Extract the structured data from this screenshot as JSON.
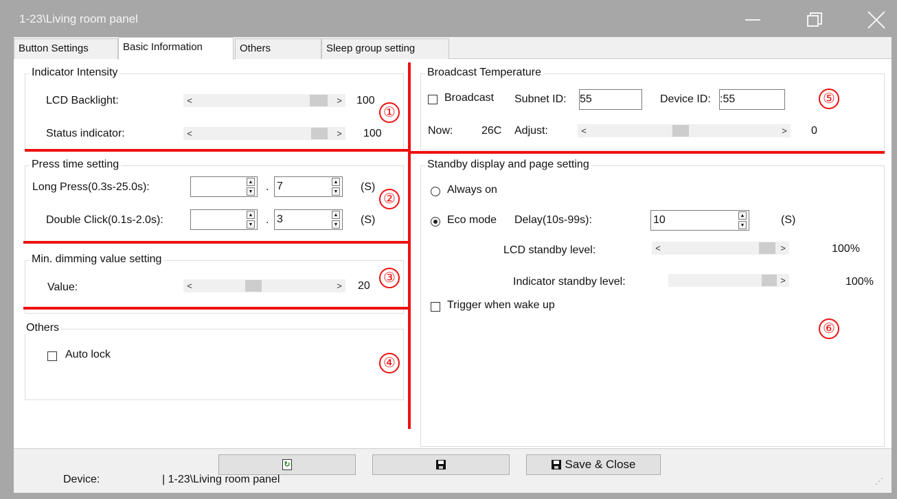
{
  "window": {
    "title": "1-23\\Living room panel",
    "minimize": "—",
    "restore": "❐",
    "close": "✕"
  },
  "tabs": [
    {
      "label": "Button Settings"
    },
    {
      "label": "Basic Information"
    },
    {
      "label": "Others"
    },
    {
      "label": "Sleep group setting"
    }
  ],
  "indicator": {
    "title": "Indicator Intensity",
    "lcd_label": "LCD Backlight:",
    "lcd_value": "100",
    "status_label": "Status indicator:",
    "status_value": "100"
  },
  "press": {
    "title": "Press time setting",
    "long_label": "Long Press(0.3s-25.0s):",
    "long_int": "",
    "long_frac": "7",
    "double_label": "Double Click(0.1s-2.0s):",
    "double_int": "",
    "double_frac": "3",
    "dot": ".",
    "unit": "(S)"
  },
  "dimming": {
    "title": "Min. dimming value setting",
    "value_label": "Value:",
    "value": "20"
  },
  "others": {
    "title": "Others",
    "auto_lock": "Auto lock"
  },
  "broadcast": {
    "title": "Broadcast Temperature",
    "broadcast_label": "Broadcast",
    "subnet_label": "Subnet ID:",
    "subnet_value": "55",
    "device_label": "Device ID:",
    "device_value": ":55",
    "now_label": "Now:",
    "now_value": "26C",
    "adjust_label": "Adjust:",
    "adjust_value": "0"
  },
  "standby": {
    "title": "Standby display and page setting",
    "always_on": "Always on",
    "eco_mode": "Eco mode",
    "delay_label": "Delay(10s-99s):",
    "delay_value": "10",
    "unit": "(S)",
    "lcd_level_label": "LCD standby level:",
    "lcd_level_value": "100%",
    "indicator_level_label": "Indicator standby level:",
    "indicator_level_value": "100%",
    "trigger_label": "Trigger when wake up"
  },
  "markers": [
    "①",
    "②",
    "③",
    "④",
    "⑤",
    "⑥"
  ],
  "footer": {
    "save_close": "Save & Close",
    "device_label": "Device:",
    "device_value": "| 1-23\\Living room panel",
    "grip": "⋰"
  },
  "colors": {
    "annotation_red": "#ee1111",
    "titlebar": "#a7a7a7",
    "scroll_thumb": "#cdcdcd"
  }
}
